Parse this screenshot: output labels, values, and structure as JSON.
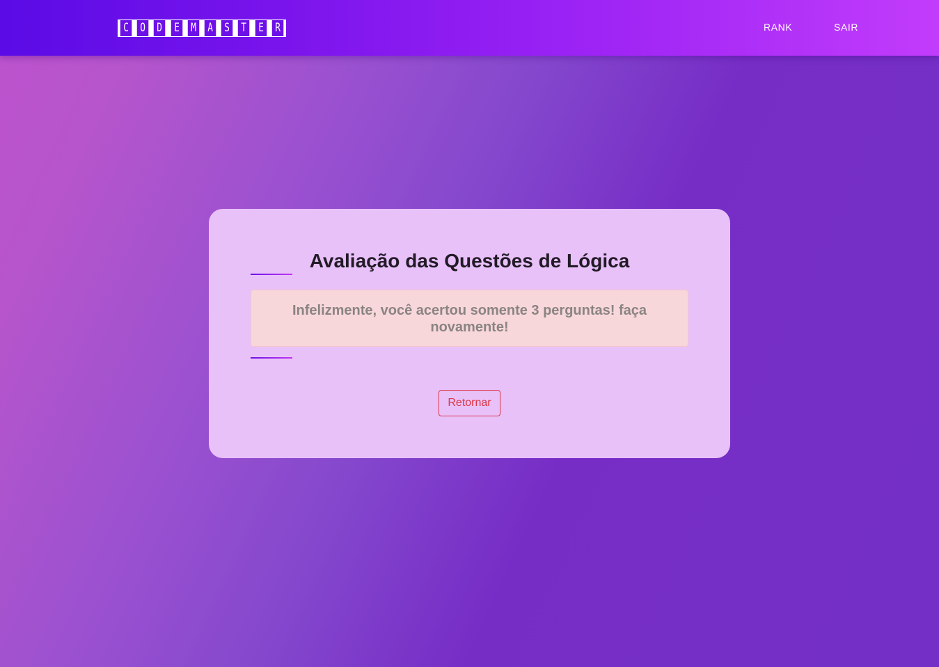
{
  "navbar": {
    "logo_letters": [
      "C",
      "O",
      "D",
      "E",
      "M",
      "A",
      "S",
      "T",
      "E",
      "R"
    ],
    "links": [
      {
        "label": "RANK"
      },
      {
        "label": "SAIR"
      }
    ]
  },
  "card": {
    "title": "Avaliação das Questões de Lógica",
    "result_message": "Infelizmente, você acertou somente 3 perguntas! faça novamente!",
    "return_button_label": "Retornar"
  },
  "colors": {
    "navbar_start": "#5a0be6",
    "navbar_end": "#c23cfb",
    "card_background": "#e9c1f9",
    "alert_background": "#f8d7da",
    "danger": "#dc3545"
  }
}
